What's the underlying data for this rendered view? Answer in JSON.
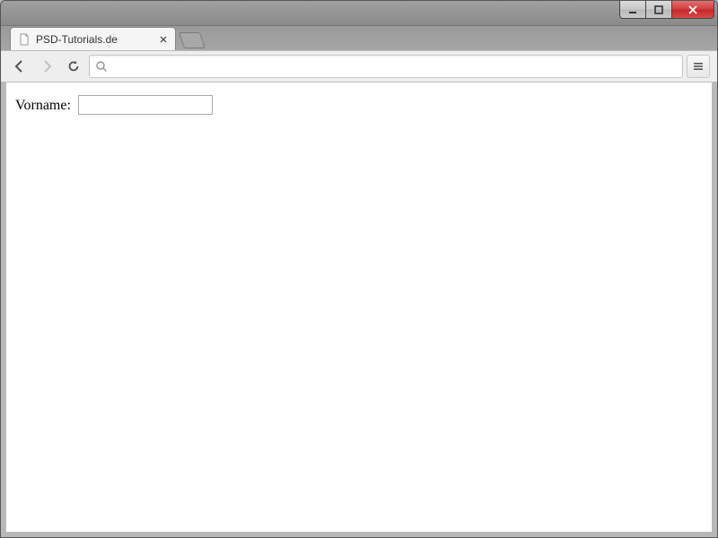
{
  "window": {
    "controls": {
      "minimize": "minimize",
      "maximize": "maximize",
      "close": "close"
    }
  },
  "browser": {
    "tab": {
      "title": "PSD-Tutorials.de"
    },
    "address": {
      "value": "",
      "placeholder": ""
    }
  },
  "page": {
    "form": {
      "firstname_label": "Vorname:",
      "firstname_value": ""
    }
  }
}
